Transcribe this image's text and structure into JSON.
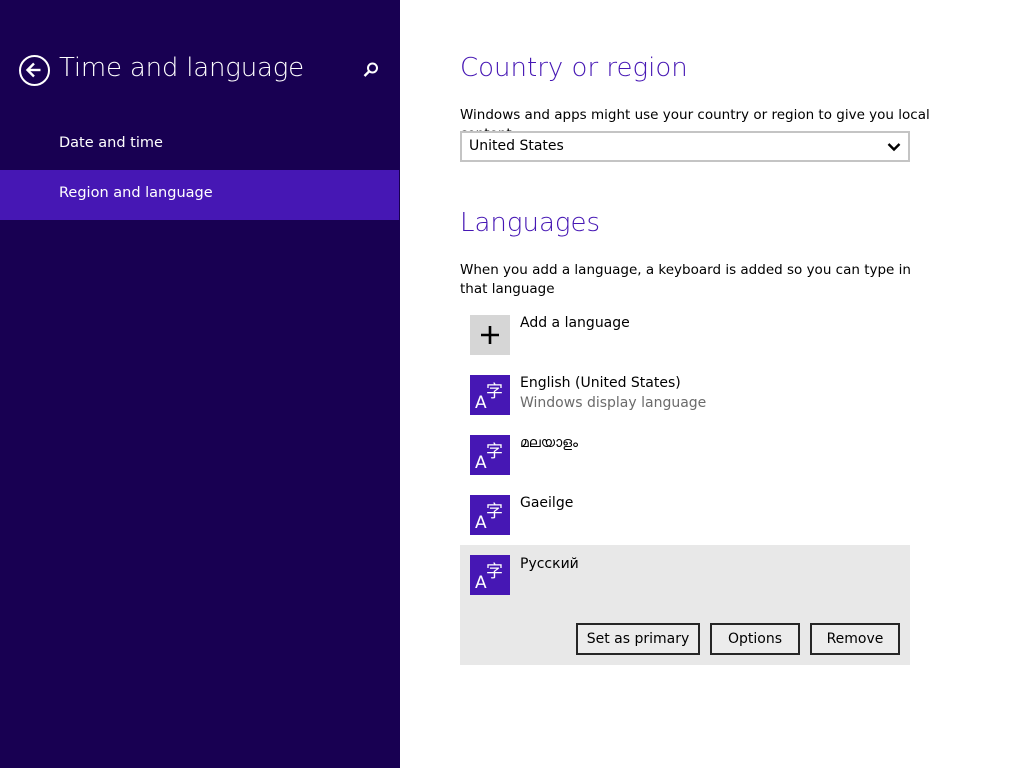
{
  "sidebar": {
    "title": "Time and language",
    "items": [
      {
        "label": "Date and time",
        "selected": false
      },
      {
        "label": "Region and language",
        "selected": true
      }
    ]
  },
  "country": {
    "heading": "Country or region",
    "description": "Windows and apps might use your country or region to give you local content",
    "selected_value": "United States"
  },
  "languages": {
    "heading": "Languages",
    "description": "When you add a language, a keyboard is added so you can type in that language",
    "add_label": "Add a language",
    "items": [
      {
        "name": "English (United States)",
        "subtitle": "Windows display language"
      },
      {
        "name": "മലയാളം",
        "subtitle": ""
      },
      {
        "name": "Gaeilge",
        "subtitle": ""
      },
      {
        "name": "Русский",
        "subtitle": ""
      }
    ],
    "actions": {
      "set_primary": "Set as primary",
      "options": "Options",
      "remove": "Remove"
    }
  },
  "colors": {
    "sidebar_bg": "#180052",
    "accent": "#4617b4",
    "selected_row_bg": "#e8e8e8"
  }
}
